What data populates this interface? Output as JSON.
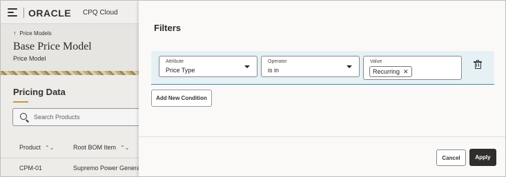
{
  "background": {
    "logo": "ORACLE",
    "product": "CPQ Cloud",
    "breadcrumb": "Price Models",
    "page_title": "Base Price Model",
    "page_subtitle": "Price Model",
    "section_title": "Pricing Data",
    "search_placeholder": "Search Products",
    "columns": [
      "Product",
      "Root BOM Item"
    ],
    "rows": [
      {
        "product": "CPM-01",
        "root_bom_item": "Supremo Power Generator"
      }
    ]
  },
  "drawer": {
    "title": "Filters",
    "condition": {
      "attribute_label": "Attribute",
      "attribute_value": "Price Type",
      "operator_label": "Operator",
      "operator_value": "is in",
      "value_label": "Value",
      "value_chips": [
        "Recurring"
      ]
    },
    "add_condition_label": "Add New Condition",
    "cancel_label": "Cancel",
    "apply_label": "Apply"
  },
  "icons": {
    "menu": "hamburger-menu-icon",
    "back": "arrow-up-icon",
    "search": "search-icon",
    "sort": "sort-icon",
    "dropdown": "chevron-down-icon",
    "remove_chip": "close-icon",
    "delete": "trash-icon"
  },
  "colors": {
    "accent": "#3f88a8",
    "condition_row_bg": "#e6f1f6",
    "apply_button": "#312d2a",
    "section_underline": "#c9a13f"
  }
}
